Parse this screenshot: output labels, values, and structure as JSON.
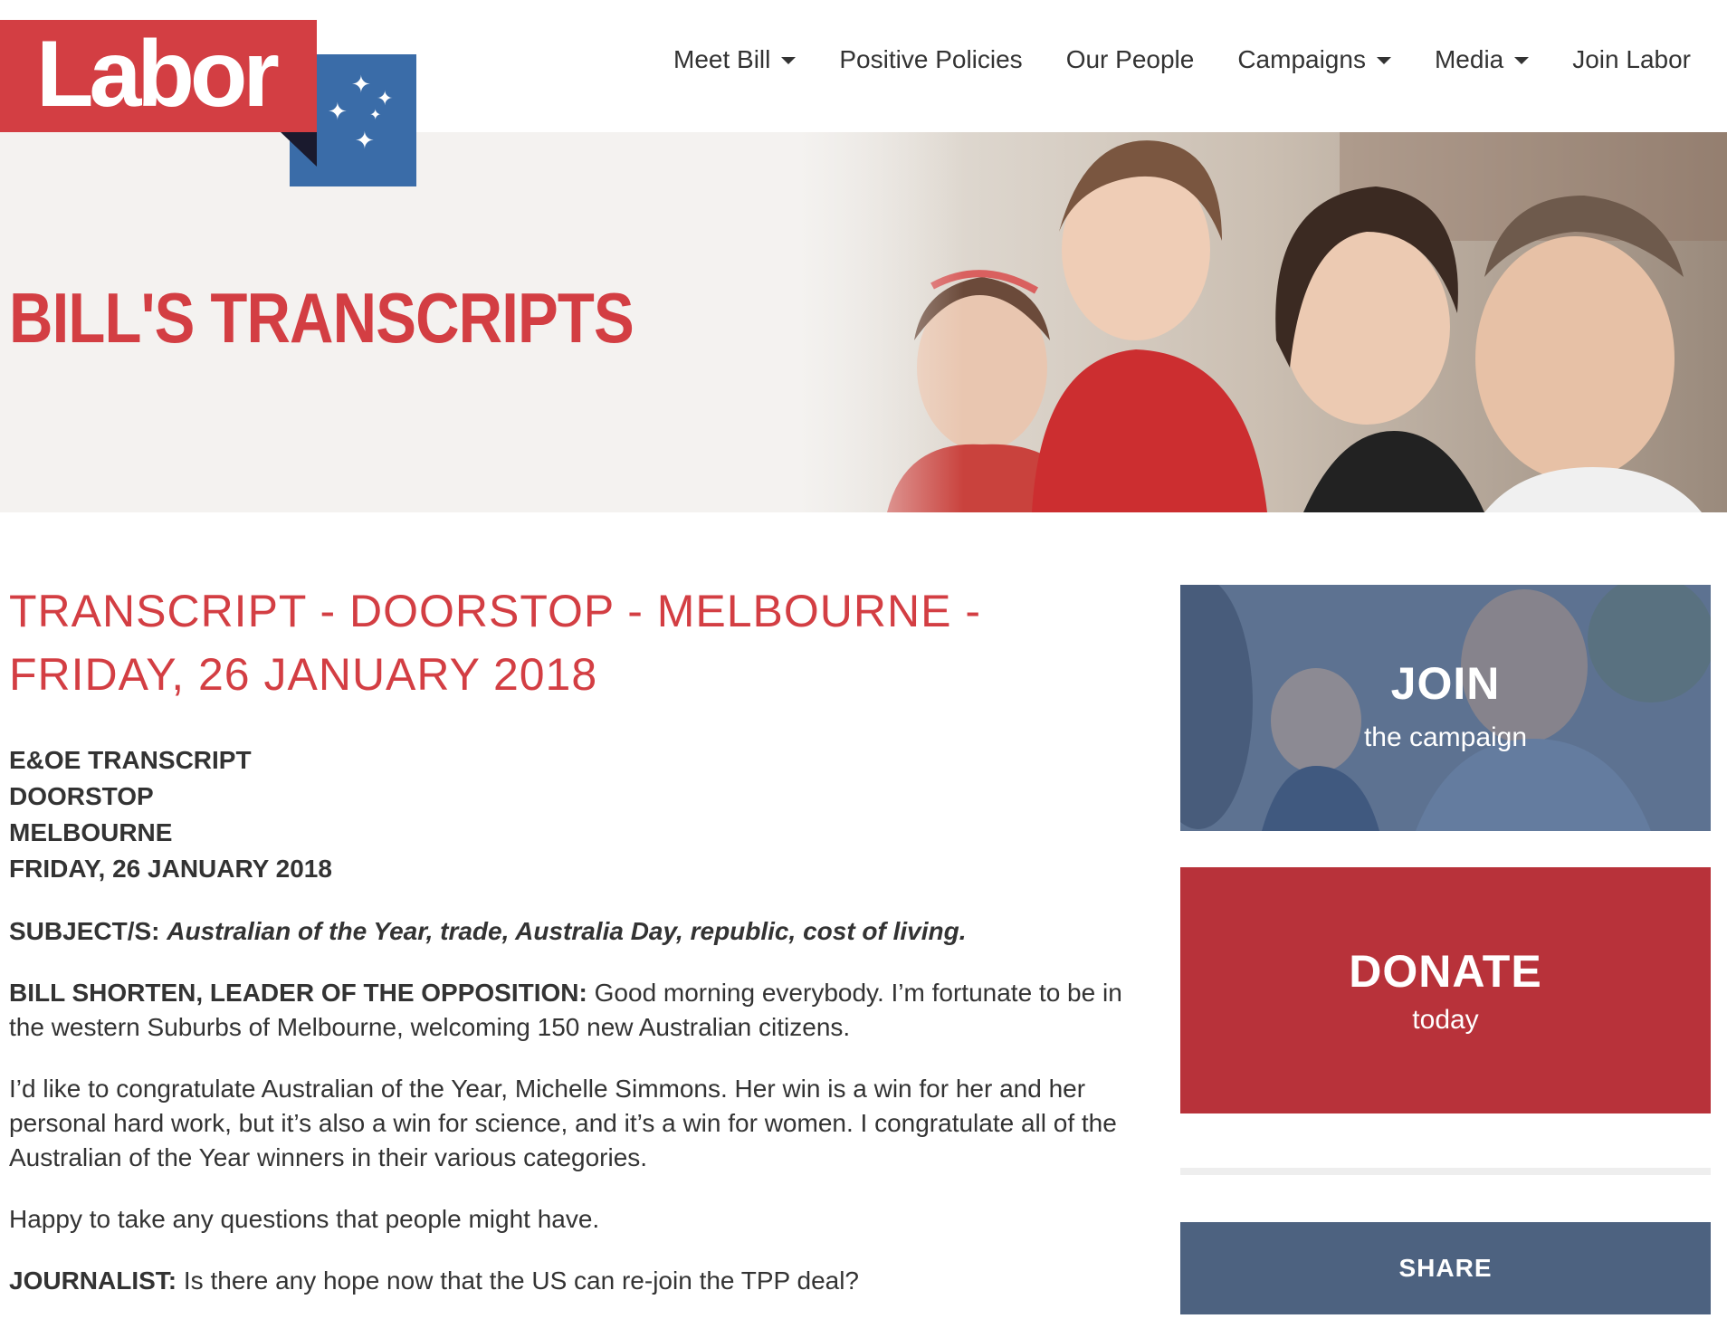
{
  "logo": {
    "text": "Labor"
  },
  "nav": {
    "items": [
      {
        "label": "Meet Bill",
        "dropdown": true
      },
      {
        "label": "Positive Policies",
        "dropdown": false
      },
      {
        "label": "Our People",
        "dropdown": false
      },
      {
        "label": "Campaigns",
        "dropdown": true
      },
      {
        "label": "Media",
        "dropdown": true
      },
      {
        "label": "Join Labor",
        "dropdown": false
      }
    ]
  },
  "hero": {
    "title": "BILL'S TRANSCRIPTS"
  },
  "article": {
    "title_line1": "TRANSCRIPT - DOORSTOP - MELBOURNE -",
    "title_line2": "FRIDAY, 26 JANUARY 2018",
    "meta": [
      "E&OE TRANSCRIPT",
      "DOORSTOP",
      "MELBOURNE",
      "FRIDAY, 26 JANUARY 2018"
    ],
    "subject_label": "SUBJECT/S:",
    "subject_text": "Australian of the Year, trade, Australia Day, republic, cost of living.",
    "p1_speaker": "BILL SHORTEN, LEADER OF THE OPPOSITION:",
    "p1_text": " Good morning everybody. I’m fortunate to be in the western Suburbs of Melbourne, welcoming 150 new Australian citizens.",
    "p2_text": "I’d like to congratulate Australian of the Year, Michelle Simmons. Her win is a win for her and her personal hard work, but it’s also a win for science, and it’s a win for women. I congratulate all of the Australian of the Year winners in their various categories.",
    "p3_text": "Happy to take any questions that people might have.",
    "p4_speaker": "JOURNALIST:",
    "p4_text": " Is there any hope now that the US can re-join the TPP deal?"
  },
  "sidebar": {
    "join_title": "JOIN",
    "join_sub": "the campaign",
    "donate_title": "DONATE",
    "donate_sub": "today",
    "share_label": "SHARE"
  },
  "colors": {
    "brand_red": "#d33e43",
    "donate_red": "#b8323a",
    "brand_blue": "#3a6ca8",
    "share_blue": "#4d6280",
    "text": "#333333"
  },
  "icons": {
    "caret": "caret-down-icon",
    "stars": "southern-cross-stars-icon"
  }
}
